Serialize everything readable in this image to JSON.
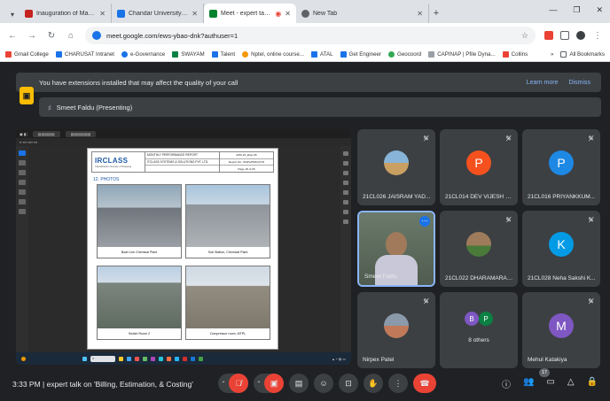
{
  "browser": {
    "tabs": [
      {
        "title": "Inauguration of Mathematographi",
        "favicon_color": "#c5221f"
      },
      {
        "title": "Chandar University of Science | ",
        "favicon_color": "#1a73e8"
      },
      {
        "title": "Meet - expert talk on 'Billi",
        "favicon_color": "#00832d"
      },
      {
        "title": "New Tab",
        "favicon_color": "#5f6368"
      }
    ],
    "url": "meet.google.com/ews-ybao-dnk?authuser=1",
    "bookmarks": [
      {
        "label": "Gmail College",
        "color": "#ea4335"
      },
      {
        "label": "CHARUSAT Intranet",
        "color": "#1a73e8"
      },
      {
        "label": "e-Governance",
        "color": "#1a73e8"
      },
      {
        "label": "SWAYAM",
        "color": "#0b8043"
      },
      {
        "label": "Talent",
        "color": "#1a73e8"
      },
      {
        "label": "Nptel, online course...",
        "color": "#f29900"
      },
      {
        "label": "ATAL",
        "color": "#1a73e8"
      },
      {
        "label": "Get Engineer",
        "color": "#1a73e8"
      },
      {
        "label": "Geocoord",
        "color": "#34a853"
      },
      {
        "label": "CAPINAP | Pfile Dyna...",
        "color": "#9aa0a6"
      },
      {
        "label": "Collins",
        "color": "#ea4335"
      }
    ],
    "all_bookmarks": "All Bookmarks"
  },
  "meet": {
    "extension_banner": {
      "message": "You have extensions installed that may affect the quality of your call",
      "learn_more": "Learn more",
      "dismiss": "Dismiss"
    },
    "presenter_banner": "Smeet Faldu (Presenting)",
    "shared_doc": {
      "logo_main": "IR",
      "logo_accent": "CLASS",
      "logo_sub": "Classification Society of Shipping",
      "header_mid": [
        "MONTHLY PERFORMANCE REPORT",
        "ITCLASS SYSTEMS & SOLUTIONS PVT. LTD.",
        ""
      ],
      "header_right": [
        "APR-23_Elon-06",
        "Report No: ISSPL/PMC/2178",
        "Page 18 of 25"
      ],
      "section_title": "12. PHOTOS",
      "photos": [
        {
          "caption": "Boat Line Chemical Plant",
          "sky": "#8fa6b8",
          "ground": "#7a7f86"
        },
        {
          "caption": "Sub Station, Chemical Plant",
          "sky": "#a8c4dc",
          "ground": "#9aa0a6"
        },
        {
          "caption": "Switch Room 2",
          "sky": "#b9cfe4",
          "ground": "#6e7a70"
        },
        {
          "caption": "Compressor room, MTPL",
          "sky": "#cfd9e3",
          "ground": "#8a8478"
        }
      ]
    },
    "participants": [
      {
        "label": "21CL026 JAISRAM YAD...",
        "initial": "",
        "avatar_color": "#5f8fb8"
      },
      {
        "label": "21CL014 DEV VIJESH PA...",
        "initial": "P",
        "avatar_color": "#f4511e"
      },
      {
        "label": "21CL016 PRIYANKKUM...",
        "initial": "P",
        "avatar_color": "#1e88e5"
      },
      {
        "label": "Smeet Faldu",
        "initial": "",
        "avatar_color": "#5a6b5a"
      },
      {
        "label": "21CL022 DHARAMARAJ...",
        "initial": "",
        "avatar_color": "#8a6a4a"
      },
      {
        "label": "21CL028 Neha Sakshi K...",
        "initial": "K",
        "avatar_color": "#039be5"
      },
      {
        "label": "Nirpex Patel",
        "initial": "",
        "avatar_color": "#7a8a9a"
      },
      {
        "label": "8 others",
        "initial": "",
        "avatar_color": ""
      },
      {
        "label": "Mehul Katakiya",
        "initial": "M",
        "avatar_color": "#7e57c2"
      }
    ],
    "others_avatars": [
      {
        "initial": "B",
        "color": "#7e57c2"
      },
      {
        "initial": "P",
        "color": "#0b8043"
      }
    ],
    "meeting_info": "3:33 PM  |  expert talk on 'Billing, Estimation, & Costing'",
    "people_count": "17"
  }
}
